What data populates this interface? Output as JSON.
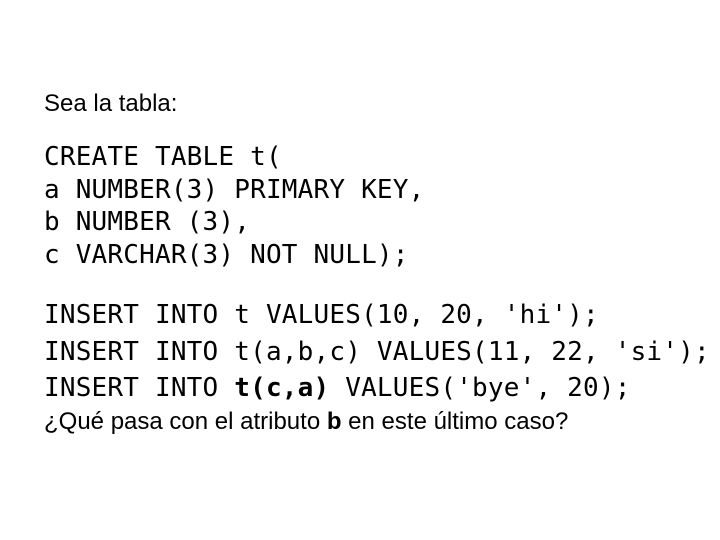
{
  "intro": "Sea la tabla:",
  "code1": {
    "l1": "CREATE TABLE t(",
    "l2": "a NUMBER(3) PRIMARY KEY,",
    "l3": "b NUMBER (3),",
    "l4": "c VARCHAR(3) NOT NULL);"
  },
  "code2": {
    "l1": "INSERT INTO t VALUES(10, 20, 'hi');",
    "l2": "INSERT INTO t(a,b,c) VALUES(11, 22, 'si');",
    "l3a": "INSERT INTO ",
    "l3b": "t(c,a)",
    "l3c": " VALUES('bye', 20);"
  },
  "question": {
    "p1": "¿Qué pasa con el atributo ",
    "b": "b",
    "p2": " en este último caso?"
  }
}
